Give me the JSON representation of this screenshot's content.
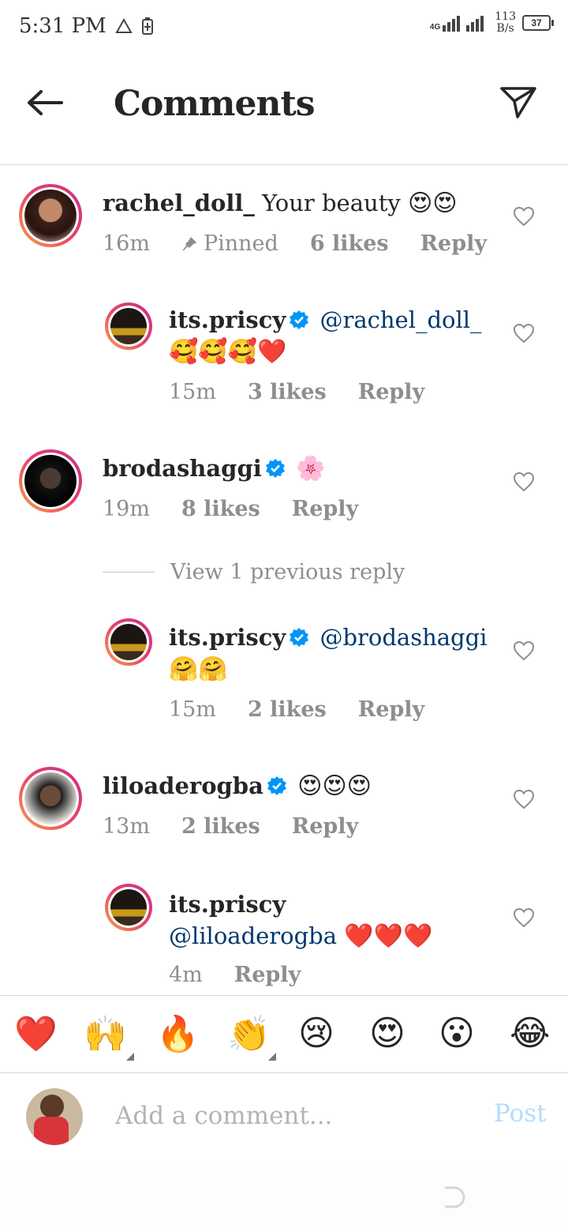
{
  "status_bar": {
    "time": "5:31 PM",
    "network": "4G",
    "speed_value": "113",
    "speed_unit": "B/s",
    "battery": "37"
  },
  "header": {
    "title": "Comments",
    "back_icon": "arrow-left-icon",
    "send_icon": "paper-plane-icon"
  },
  "comments": [
    {
      "username": "rachel_doll_",
      "text": "Your beauty",
      "emoji": "😍😍",
      "time": "16m",
      "pinned_label": "Pinned",
      "likes": "6 likes",
      "reply_label": "Reply"
    },
    {
      "username": "its.priscy",
      "verified": true,
      "mention": "@rachel_doll_",
      "emoji": "🥰🥰🥰❤️",
      "time": "15m",
      "likes": "3 likes",
      "reply_label": "Reply"
    },
    {
      "username": "brodashaggi",
      "verified": true,
      "emoji": "🌸",
      "time": "19m",
      "likes": "8 likes",
      "reply_label": "Reply",
      "view_previous": "View 1 previous reply"
    },
    {
      "username": "its.priscy",
      "verified": true,
      "mention": "@brodashaggi",
      "emoji": "🤗🤗",
      "time": "15m",
      "likes": "2 likes",
      "reply_label": "Reply"
    },
    {
      "username": "liloaderogba",
      "verified": true,
      "emoji": "😍😍😍",
      "time": "13m",
      "likes": "2 likes",
      "reply_label": "Reply"
    },
    {
      "username": "its.priscy",
      "mention": "@liloaderogba",
      "emoji": "❤️❤️❤️",
      "time": "4m",
      "reply_label": "Reply"
    }
  ],
  "reactions": [
    "❤️",
    "🙌",
    "🔥",
    "👏",
    "😢",
    "😍",
    "😮",
    "😂"
  ],
  "composer": {
    "placeholder": "Add a comment...",
    "post_label": "Post"
  },
  "colors": {
    "text": "#262626",
    "muted": "#8e8e8e",
    "mention": "#00376b",
    "verified": "#0095f6",
    "post_disabled": "#b3dbff"
  }
}
